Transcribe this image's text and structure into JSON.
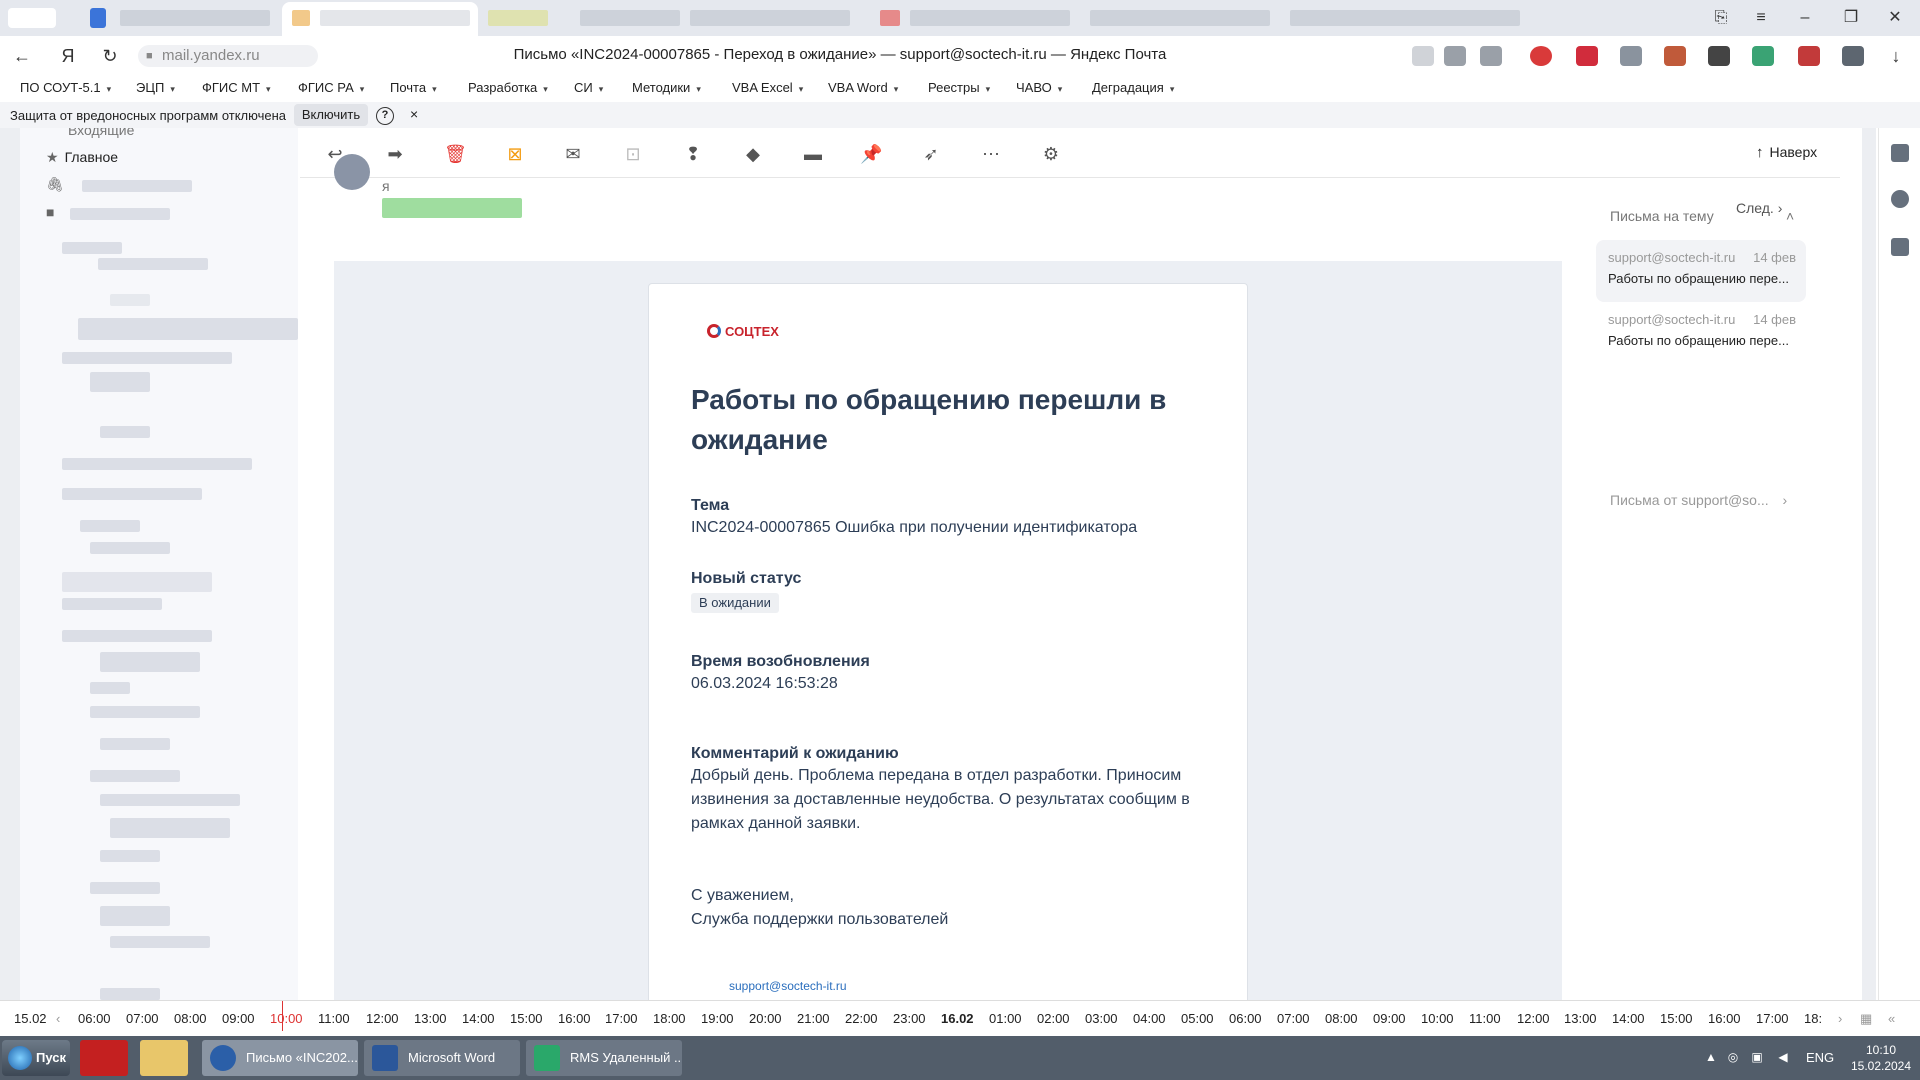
{
  "browser": {
    "url_domain": "mail.yandex.ru",
    "page_title": "Письмо «INC2024-00007865 - Переход в ожидание» — support@soctech-it.ru — Яндекс Почта"
  },
  "bookmarks": [
    "ПО СОУТ-5.1",
    "ЭЦП",
    "ФГИС МТ",
    "ФГИС РА",
    "Почта",
    "Разработка",
    "СИ",
    "Методики",
    "VBA Excel",
    "VBA Word",
    "Реестры",
    "ЧАВО",
    "Деградация"
  ],
  "security_bar": {
    "text": "Защита от вредоносных программ отключена",
    "enable_label": "Включить",
    "help": "?",
    "close": "×"
  },
  "sidebar": {
    "item_inbox": "Входящие",
    "item_main": "Главное"
  },
  "toolbar": {
    "up_label": "Наверх"
  },
  "message": {
    "sender_label": "я",
    "next_label": "След.",
    "logo_text": "СОЦТЕХ",
    "heading": "Работы по обращению перешли в ожидание",
    "topic_label": "Тема",
    "topic_value": "INC2024-00007865 Ошибка при получении идентификатора",
    "status_label": "Новый статус",
    "status_value": "В ожидании",
    "resume_label": "Время возобновления",
    "resume_value": "06.03.2024 16:53:28",
    "comment_label": "Комментарий к ожиданию",
    "comment_value": "Добрый день. Проблема передана в отдел разработки. Приносим извинения за доставленные неудобства. О результатах сообщим в рамках данной заявки.",
    "regards": "С уважением,",
    "team": "Служба поддержки пользователей",
    "email": "support@soctech-it.ru"
  },
  "thread": {
    "header": "Письма на тему",
    "items": [
      {
        "from": "support@soctech-it.ru",
        "date": "14 фев",
        "subject": "Работы по обращению пере..."
      },
      {
        "from": "support@soctech-it.ru",
        "date": "14 фев",
        "subject": "Работы по обращению пере..."
      }
    ],
    "from_link": "Письма от support@so..."
  },
  "timeline": {
    "date_start": "15.02",
    "hours": [
      "06:00",
      "07:00",
      "08:00",
      "09:00",
      "10:00",
      "11:00",
      "12:00",
      "13:00",
      "14:00",
      "15:00",
      "16:00",
      "17:00",
      "18:00",
      "19:00",
      "20:00",
      "21:00",
      "22:00",
      "23:00",
      "16.02",
      "01:00",
      "02:00",
      "03:00",
      "04:00",
      "05:00",
      "06:00",
      "07:00",
      "08:00",
      "09:00",
      "10:00",
      "11:00",
      "12:00",
      "13:00",
      "14:00",
      "15:00",
      "16:00",
      "17:00",
      "18:"
    ]
  },
  "taskbar": {
    "start_label": "Пуск",
    "tasks": [
      "Письмо «INC202...",
      "Microsoft Word",
      "RMS Удаленный ..."
    ],
    "lang": "ENG",
    "time": "10:10",
    "date": "15.02.2024"
  },
  "colors": {
    "heading": "#2d3e56",
    "brand_red": "#c8232c",
    "link": "#2a6ebd",
    "taskbar": "#525d6a"
  }
}
